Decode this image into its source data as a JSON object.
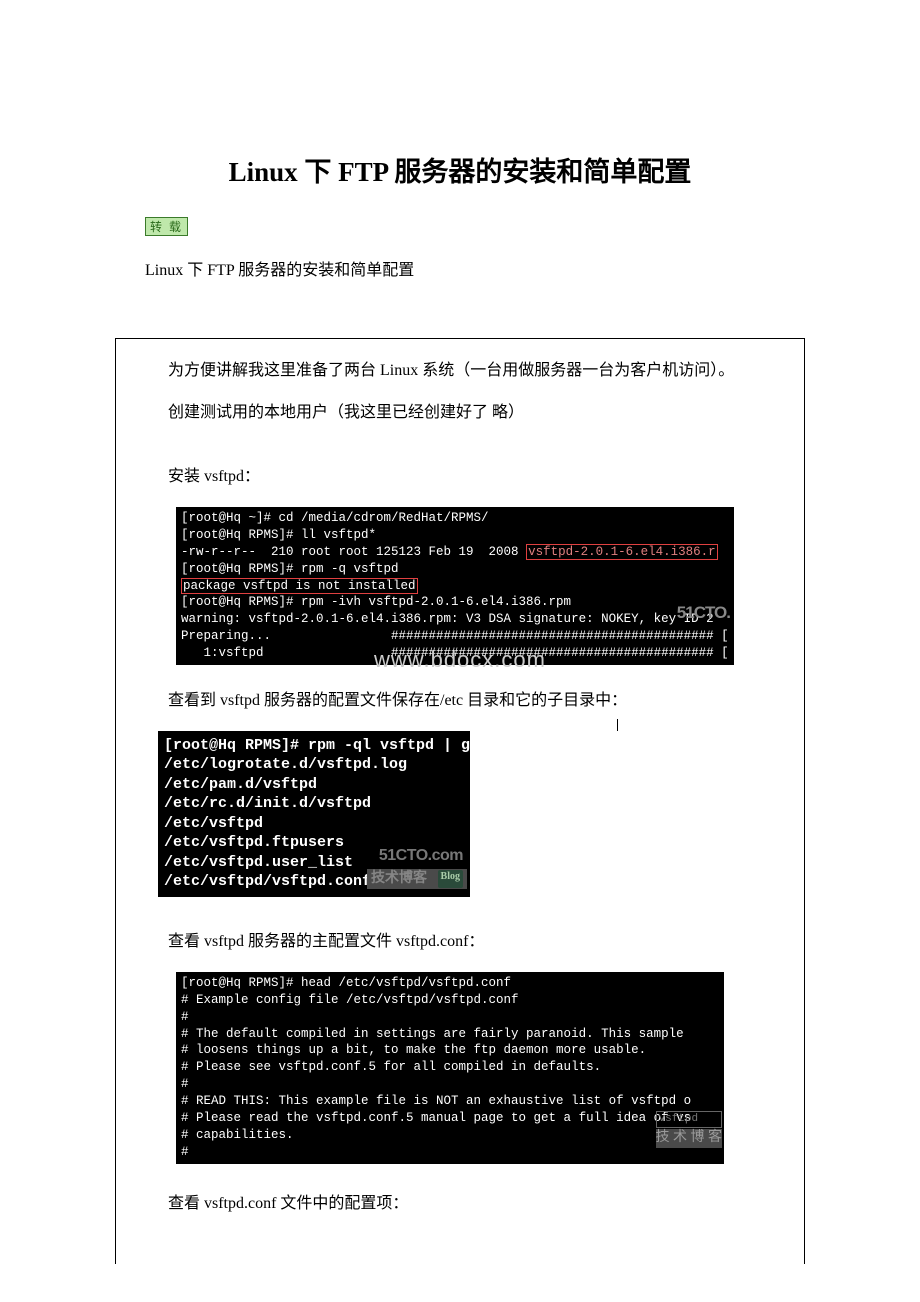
{
  "title": "Linux 下 FTP 服务器的安装和简单配置",
  "badge": "转 载",
  "intro": "Linux 下 FTP 服务器的安装和简单配置",
  "para1": "为方便讲解我这里准备了两台 Linux 系统（一台用做服务器一台为客户机访问）。",
  "para2": "创建测试用的本地用户（我这里已经创建好了 略）",
  "para3": "安装 vsftpd：",
  "term1": {
    "l1": "[root@Hq ~]# cd /media/cdrom/RedHat/RPMS/",
    "l2": "[root@Hq RPMS]# ll vsftpd*",
    "l3a": "-rw-r--r--  210 root root 125123 Feb 19  2008 ",
    "l3b": "vsftpd-2.0.1-6.el4.i386.r",
    "l4": "[root@Hq RPMS]# rpm -q vsftpd",
    "l5": "package vsftpd is not installed",
    "l6": "[root@Hq RPMS]# rpm -ivh vsftpd-2.0.1-6.el4.i386.rpm",
    "l7": "warning: vsftpd-2.0.1-6.el4.i386.rpm: V3 DSA signature: NOKEY, key ID 2",
    "l8": "Preparing...                ########################################### [",
    "l9": "   1:vsftpd                 ########################################### ["
  },
  "watermark1": "www.bdocx.com",
  "wm51cto": "51CTO.",
  "para4": "查看到 vsftpd 服务器的配置文件保存在/etc 目录和它的子目录中：",
  "term2": {
    "l1": "[root@Hq RPMS]# rpm -ql vsftpd | grep etc",
    "l2": "/etc/logrotate.d/vsftpd.log",
    "l3": "/etc/pam.d/vsftpd",
    "l4": "/etc/rc.d/init.d/vsftpd",
    "l5": "/etc/vsftpd",
    "l6": "/etc/vsftpd.ftpusers",
    "l7": "/etc/vsftpd.user_list",
    "l8": "/etc/vsftpd/vsftpd.conf"
  },
  "wm51com": "51CTO.com",
  "wmblog": "技术博客",
  "wmBlogBadge": "Blog",
  "para5": "查看 vsftpd 服务器的主配置文件 vsftpd.conf：",
  "term3": {
    "l1": "[root@Hq RPMS]# head /etc/vsftpd/vsftpd.conf",
    "l2": "# Example config file /etc/vsftpd/vsftpd.conf",
    "l3": "#",
    "l4": "# The default compiled in settings are fairly paranoid. This sample",
    "l5": "# loosens things up a bit, to make the ftp daemon more usable.",
    "l6": "# Please see vsftpd.conf.5 for all compiled in defaults.",
    "l7": "#",
    "l8": "# READ THIS: This example file is NOT an exhaustive list of vsftpd o",
    "l9": "# Please read the vsftpd.conf.5 manual page to get a full idea of vs",
    "l10": "# capabilities.",
    "l11": "#"
  },
  "wmvsftpd": "vsftpd",
  "wmtech": "技 术 博 客",
  "para6": "查看 vsftpd.conf 文件中的配置项："
}
